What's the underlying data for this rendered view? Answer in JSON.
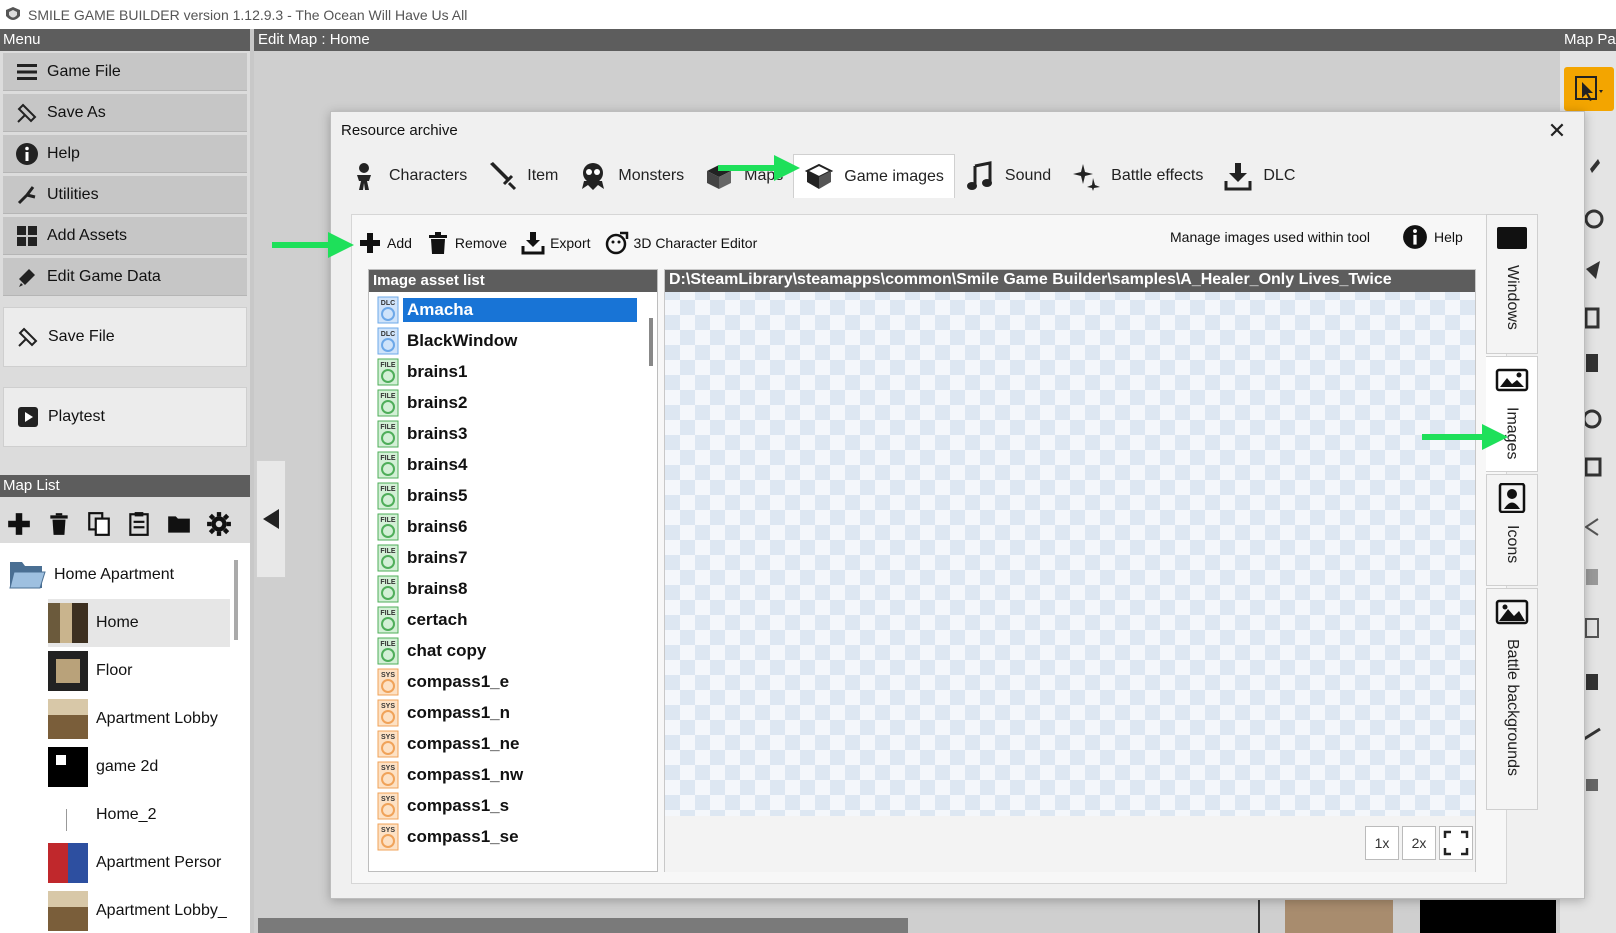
{
  "window": {
    "title": "SMILE GAME BUILDER version 1.12.9.3 - The Ocean Will Have Us All"
  },
  "left_panel": {
    "header": "Menu",
    "menu": [
      {
        "label": "Game File",
        "icon": "hamburger-icon"
      },
      {
        "label": "Save As",
        "icon": "save-as-icon"
      },
      {
        "label": "Help",
        "icon": "info-icon"
      },
      {
        "label": "Utilities",
        "icon": "utilities-icon"
      },
      {
        "label": "Add Assets",
        "icon": "add-assets-icon"
      },
      {
        "label": "Edit Game Data",
        "icon": "edit-data-icon"
      },
      {
        "label": "Save File",
        "icon": "save-file-icon"
      },
      {
        "label": "Playtest",
        "icon": "play-icon"
      }
    ],
    "maplist_header": "Map List",
    "maps": [
      {
        "label": "Home Apartment",
        "type": "folder"
      },
      {
        "label": "Home",
        "selected": true
      },
      {
        "label": "Floor"
      },
      {
        "label": "Apartment Lobby"
      },
      {
        "label": "game 2d"
      },
      {
        "label": "Home_2"
      },
      {
        "label": "Apartment Persor"
      },
      {
        "label": "Apartment Lobby_"
      }
    ]
  },
  "center": {
    "header": "Edit Map : Home"
  },
  "right_panel": {
    "header": "Map Pa"
  },
  "dialog": {
    "title": "Resource archive",
    "close": "✕",
    "tabs": [
      {
        "label": "Characters",
        "icon": "character-icon"
      },
      {
        "label": "Item",
        "icon": "sword-icon"
      },
      {
        "label": "Monsters",
        "icon": "monster-icon"
      },
      {
        "label": "Maps",
        "icon": "maps-icon"
      },
      {
        "label": "Game images",
        "icon": "game-images-icon",
        "active": true
      },
      {
        "label": "Sound",
        "icon": "music-note-icon"
      },
      {
        "label": "Battle effects",
        "icon": "sparkle-icon"
      },
      {
        "label": "DLC",
        "icon": "download-icon"
      }
    ],
    "toolbar": {
      "add": "Add",
      "remove": "Remove",
      "export": "Export",
      "char_editor": "3D Character Editor",
      "manage": "Manage images used within tool",
      "help": "Help"
    },
    "asset_list_header": "Image asset list",
    "assets": [
      {
        "name": "Amacha",
        "badge": "DLC",
        "selected": true
      },
      {
        "name": "BlackWindow",
        "badge": "DLC"
      },
      {
        "name": "brains1",
        "badge": "FILE"
      },
      {
        "name": "brains2",
        "badge": "FILE"
      },
      {
        "name": "brains3",
        "badge": "FILE"
      },
      {
        "name": "brains4",
        "badge": "FILE"
      },
      {
        "name": "brains5",
        "badge": "FILE"
      },
      {
        "name": "brains6",
        "badge": "FILE"
      },
      {
        "name": "brains7",
        "badge": "FILE"
      },
      {
        "name": "brains8",
        "badge": "FILE"
      },
      {
        "name": "certach",
        "badge": "FILE"
      },
      {
        "name": "chat copy",
        "badge": "FILE"
      },
      {
        "name": "compass1_e",
        "badge": "SYS"
      },
      {
        "name": "compass1_n",
        "badge": "SYS"
      },
      {
        "name": "compass1_ne",
        "badge": "SYS"
      },
      {
        "name": "compass1_nw",
        "badge": "SYS"
      },
      {
        "name": "compass1_s",
        "badge": "SYS"
      },
      {
        "name": "compass1_se",
        "badge": "SYS"
      }
    ],
    "path": "D:\\SteamLibrary\\steamapps\\common\\Smile Game Builder\\samples\\A_Healer_Only Lives_Twice",
    "zoom": [
      "1x",
      "2x"
    ],
    "side_tabs": [
      {
        "label": "Windows",
        "icon": "window-icon"
      },
      {
        "label": "Images",
        "icon": "image-icon",
        "active": true
      },
      {
        "label": "Icons",
        "icon": "portrait-icon"
      },
      {
        "label": "Battle backgrounds",
        "icon": "landscape-icon"
      }
    ]
  },
  "colors": {
    "accent_green": "#1ee05a",
    "selection_blue": "#1874d6",
    "header_gray": "#5d5d5d",
    "tool_orange": "#f3a500"
  }
}
